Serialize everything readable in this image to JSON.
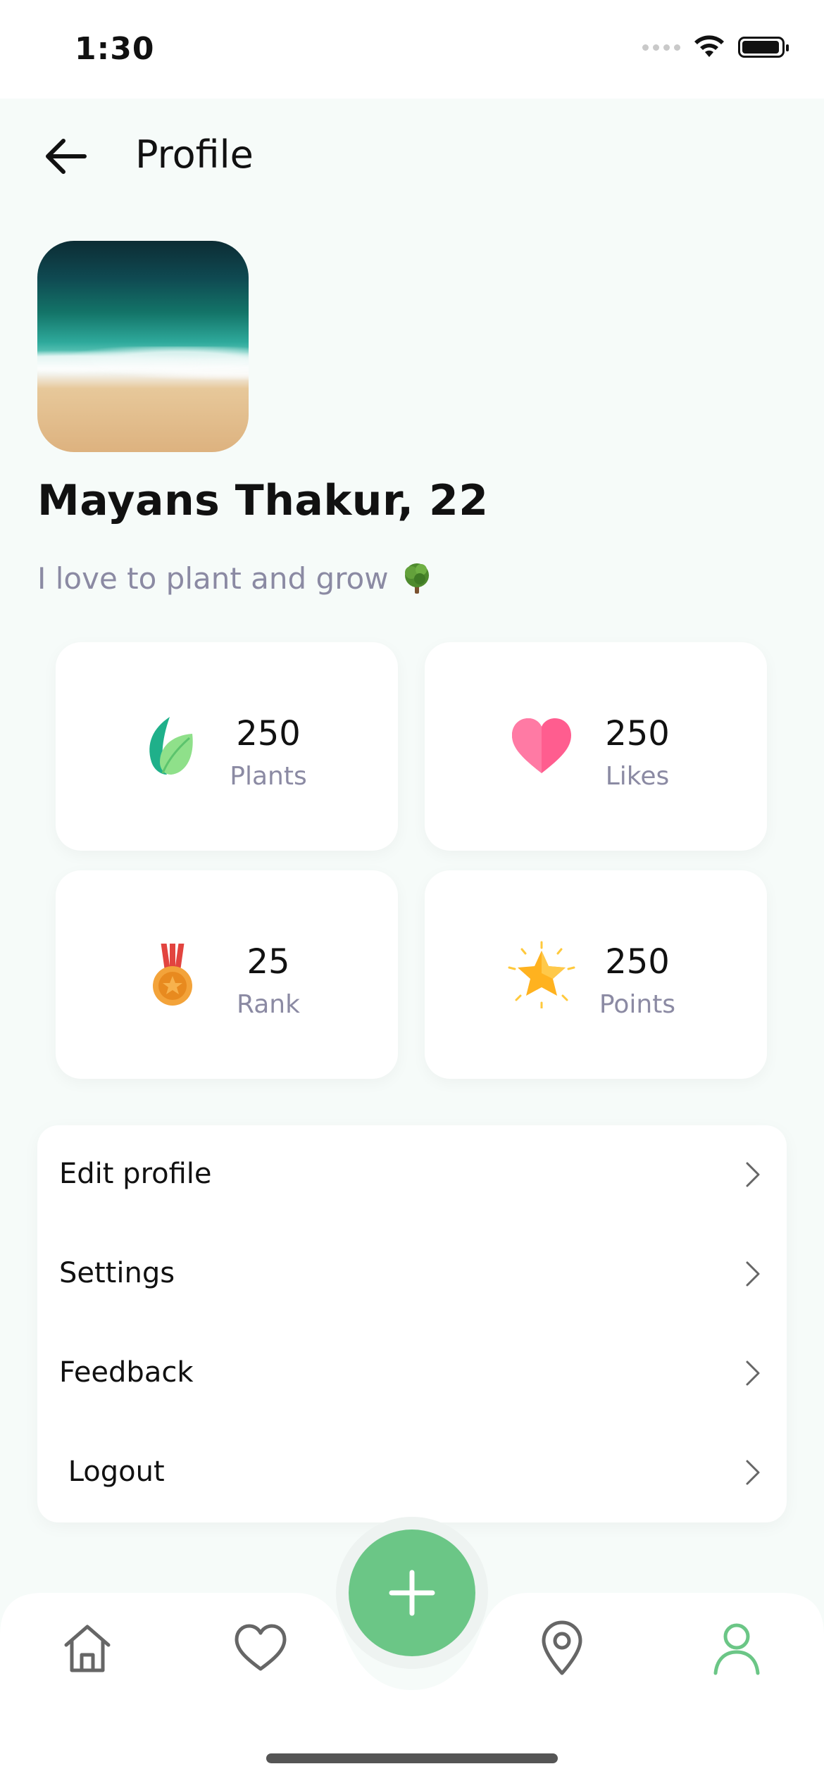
{
  "status_bar": {
    "time": "1:30"
  },
  "header": {
    "title": "Profile"
  },
  "profile": {
    "name": "Mayans Thakur, 22",
    "bio": "I love to plant and grow"
  },
  "stats": [
    {
      "value": "250",
      "label": "Plants",
      "icon": "leaf-icon"
    },
    {
      "value": "250",
      "label": "Likes",
      "icon": "heart-icon"
    },
    {
      "value": "25",
      "label": "Rank",
      "icon": "medal-icon"
    },
    {
      "value": "250",
      "label": "Points",
      "icon": "star-icon"
    }
  ],
  "menu": [
    {
      "label": "Edit profile"
    },
    {
      "label": "Settings"
    },
    {
      "label": "Feedback"
    },
    {
      "label": " Logout"
    }
  ],
  "tabbar": {
    "items": [
      "home-icon",
      "heart-outline-icon",
      "add-icon",
      "location-pin-icon",
      "user-icon"
    ],
    "active": "user-icon"
  },
  "colors": {
    "accent_green": "#6bc686",
    "muted_text": "#8b8aa3",
    "like_pink": "#ff5d8f",
    "background": "#f6fbf9"
  }
}
